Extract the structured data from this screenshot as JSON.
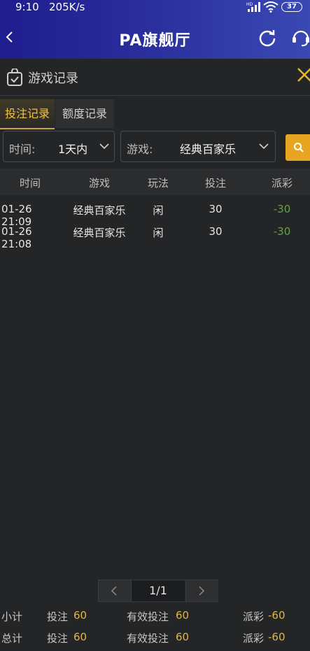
{
  "status_bar": {
    "time": "9:10",
    "speed": "205K/s",
    "battery": "37"
  },
  "header": {
    "title": "PA旗舰厅"
  },
  "panel": {
    "title": "游戏记录"
  },
  "tabs": [
    {
      "label": "投注记录",
      "active": true
    },
    {
      "label": "额度记录",
      "active": false
    }
  ],
  "filters": {
    "time_label": "时间:",
    "time_value": "1天内",
    "game_label": "游戏:",
    "game_value": "经典百家乐"
  },
  "table": {
    "columns": [
      "时间",
      "游戏",
      "玩法",
      "投注",
      "派彩"
    ],
    "rows": [
      [
        "01-26 21:09",
        "经典百家乐",
        "闲",
        "30",
        "-30"
      ],
      [
        "01-26 21:08",
        "经典百家乐",
        "闲",
        "30",
        "-30"
      ]
    ]
  },
  "pager": {
    "page": "1/1"
  },
  "totals": {
    "subtotal": {
      "label": "小计",
      "bet_label": "投注",
      "bet_value": "60",
      "valid_label": "有效投注",
      "valid_value": "60",
      "payout_label": "派彩",
      "payout_value": "-60"
    },
    "total": {
      "label": "总计",
      "bet_label": "投注",
      "bet_value": "60",
      "valid_label": "有效投注",
      "valid_value": "60",
      "payout_label": "派彩",
      "payout_value": "-60"
    }
  },
  "colors": {
    "header_start": "#1f1d8f",
    "header_end": "#3a49b3",
    "accent_gold": "#e8a521",
    "active_tab_text": "#f0c34b",
    "payout_green": "#5aa83a",
    "background": "#232527"
  },
  "icons": {
    "back": "chevron-left-icon",
    "refresh": "refresh-icon",
    "support": "headset-icon",
    "panel": "shopping-bag-check-icon",
    "close": "close-icon",
    "dropdown": "chevron-down-icon",
    "search": "search-icon"
  }
}
